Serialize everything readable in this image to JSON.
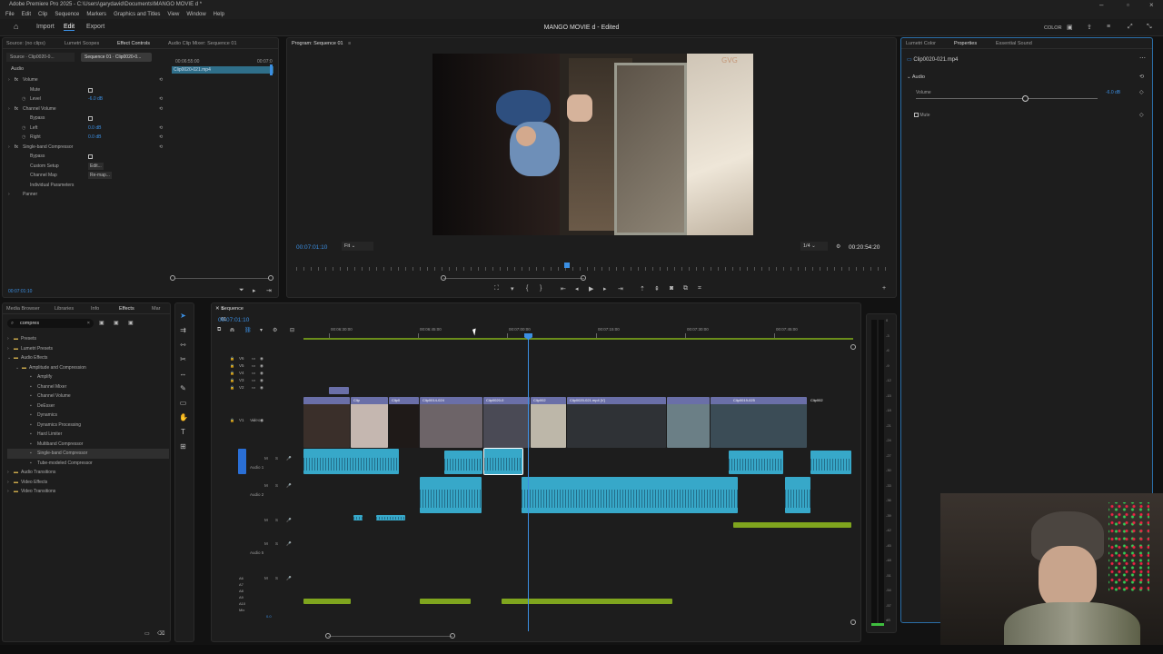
{
  "titlebar": {
    "text": "Adobe Premiere Pro 2025 - C:\\Users\\garydavid\\Documents\\MANGO MOVIE d *"
  },
  "menu": [
    "File",
    "Edit",
    "Clip",
    "Sequence",
    "Markers",
    "Graphics and Titles",
    "View",
    "Window",
    "Help"
  ],
  "workspace": {
    "home": "⌂",
    "import": "Import",
    "edit": "Edit",
    "export": "Export",
    "project_title": "MANGO MOVIE d - Edited",
    "color_label": "COLOR"
  },
  "effect_controls": {
    "tabs": [
      "Source: (no clips)",
      "Lumetri Scopes",
      "Effect Controls",
      "Audio Clip Mixer: Sequence 01"
    ],
    "source_tab": "Source · Clip0020-0...",
    "sequence_tab": "Sequence 01 · Clip0020-0...",
    "mini_clip": "Clip0020-021.mp4",
    "ruler_a": "00:06:55:00",
    "ruler_b": "00:07:0",
    "section": "Audio",
    "rows": [
      {
        "label": "Volume",
        "indent": 1,
        "fx": true
      },
      {
        "label": "Mute",
        "indent": 2,
        "checkbox": true
      },
      {
        "label": "Level",
        "indent": 2,
        "value": "-6.0 dB"
      },
      {
        "label": "Channel Volume",
        "indent": 1,
        "fx": true
      },
      {
        "label": "Bypass",
        "indent": 2,
        "checkbox": true
      },
      {
        "label": "Left",
        "indent": 2,
        "value": "0.0 dB"
      },
      {
        "label": "Right",
        "indent": 2,
        "value": "0.0 dB"
      },
      {
        "label": "Single-band Compressor",
        "indent": 1,
        "fx": true
      },
      {
        "label": "Bypass",
        "indent": 2,
        "checkbox": true
      },
      {
        "label": "Custom Setup",
        "indent": 2,
        "value": "Edit..."
      },
      {
        "label": "Channel Map",
        "indent": 2,
        "value": "Re-map..."
      },
      {
        "label": "Individual Parameters",
        "indent": 2
      },
      {
        "label": "Panner",
        "indent": 1
      }
    ],
    "timecode": "00:07:01:10"
  },
  "program": {
    "tab": "Program: Sequence 01",
    "timecode": "00:07:01:10",
    "fit": "Fit",
    "resolution": "1/4",
    "duration": "00:20:54:20",
    "playhead": 0.455
  },
  "properties": {
    "tabs": [
      "Lumetri Color",
      "Properties",
      "Essential Sound"
    ],
    "file": "Clip0020-021.mp4",
    "section": "Audio",
    "volume_label": "Volume",
    "volume_value": "-6.0 dB",
    "volume_level": 0.6,
    "mute_label": "Mute"
  },
  "effects_panel": {
    "tabs": [
      "Media Browser",
      "Libraries",
      "Info",
      "Effects",
      "Mar"
    ],
    "search": "compres",
    "tree": [
      {
        "label": "Presets",
        "level": 0,
        "folder": true
      },
      {
        "label": "Lumetri Presets",
        "level": 0,
        "folder": true
      },
      {
        "label": "Audio Effects",
        "level": 0,
        "folder": true,
        "open": true
      },
      {
        "label": "Amplitude and Compression",
        "level": 1,
        "folder": true,
        "open": true
      },
      {
        "label": "Amplify",
        "level": 2
      },
      {
        "label": "Channel Mixer",
        "level": 2
      },
      {
        "label": "Channel Volume",
        "level": 2
      },
      {
        "label": "DeEsser",
        "level": 2
      },
      {
        "label": "Dynamics",
        "level": 2
      },
      {
        "label": "Dynamics Processing",
        "level": 2
      },
      {
        "label": "Hard Limiter",
        "level": 2
      },
      {
        "label": "Multiband Compressor",
        "level": 2
      },
      {
        "label": "Single-band Compressor",
        "level": 2,
        "selected": true
      },
      {
        "label": "Tube-modeled Compressor",
        "level": 2
      },
      {
        "label": "Audio Transitions",
        "level": 0,
        "folder": true
      },
      {
        "label": "Video Effects",
        "level": 0,
        "folder": true
      },
      {
        "label": "Video Transitions",
        "level": 0,
        "folder": true
      }
    ]
  },
  "timeline": {
    "tab": "Sequence 01",
    "timecode": "00:07:01:10",
    "ruler": [
      "00:06:30:00",
      "00:06:45:00",
      "00:07:00:00",
      "00:07:15:00",
      "00:07:30:00",
      "00:07:45:00"
    ],
    "video_tracks": [
      "V6",
      "V5",
      "V4",
      "V3",
      "V2",
      "V1"
    ],
    "v1_name": "Video 1",
    "a1_name": "Audio 1",
    "a2_name": "Audio 2",
    "a5_name": "Audio 5",
    "small_tracks": [
      "A6",
      "A7",
      "A8",
      "A9",
      "A10",
      "Mix"
    ],
    "mix_value": "0.0",
    "video_clip_labels": [
      "Clip",
      "Clip0",
      "Clip0014-024",
      "Clip0020-0",
      "Clip002",
      "Clip0020-021.mp4 [V]",
      "Clip0019-025",
      "Clip002"
    ],
    "meter_scale": [
      "0",
      "-3",
      "-6",
      "-9",
      "-12",
      "-15",
      "-18",
      "-21",
      "-24",
      "-27",
      "-30",
      "-33",
      "-36",
      "-39",
      "-42",
      "-45",
      "-48",
      "-51",
      "-54",
      "-57",
      "dB"
    ]
  },
  "colors": {
    "accent": "#3b8fe3",
    "audio": "#37a8c9",
    "video": "#6a6fa8",
    "green": "#7fa51e",
    "selected_clip": "#5ad1ff"
  }
}
